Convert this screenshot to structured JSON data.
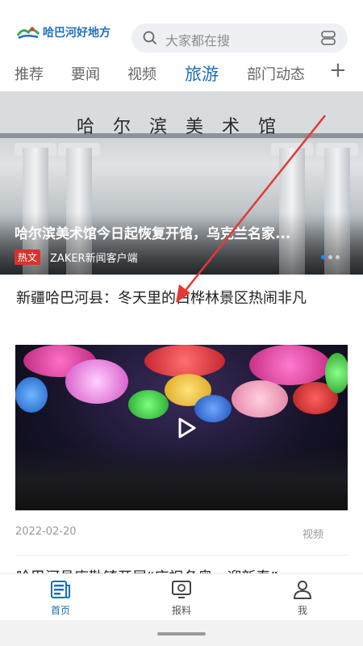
{
  "header": {
    "app_name": "哈巴河好地方",
    "search_placeholder": "大家都在搜"
  },
  "tabs": [
    {
      "label": "推荐",
      "active": false
    },
    {
      "label": "要闻",
      "active": false
    },
    {
      "label": "视频",
      "active": false
    },
    {
      "label": "旅游",
      "active": true
    },
    {
      "label": "部门动态",
      "active": false
    }
  ],
  "tab_add_label": "+",
  "hero": {
    "sign_text": "哈尔滨美术馆",
    "title": "哈尔滨美术馆今日起恢复开馆，乌克兰名家...",
    "badge": "热文",
    "source": "ZAKER新闻客户端"
  },
  "article": {
    "title": "新疆哈巴河县：冬天里的白桦林景区热闹非凡",
    "date": "2022-02-20",
    "type": "视频"
  },
  "next_article": {
    "title": "哈巴河县库勒镇开展“庆祝冬奥，迎新春”"
  },
  "bottom_nav": [
    {
      "label": "首页",
      "icon": "home-news-icon",
      "active": true
    },
    {
      "label": "报料",
      "icon": "report-icon",
      "active": false
    },
    {
      "label": "我",
      "icon": "profile-icon",
      "active": false
    }
  ],
  "colors": {
    "accent": "#1a6fb8",
    "badge": "#d8322e",
    "annotation_arrow": "#e53935"
  }
}
